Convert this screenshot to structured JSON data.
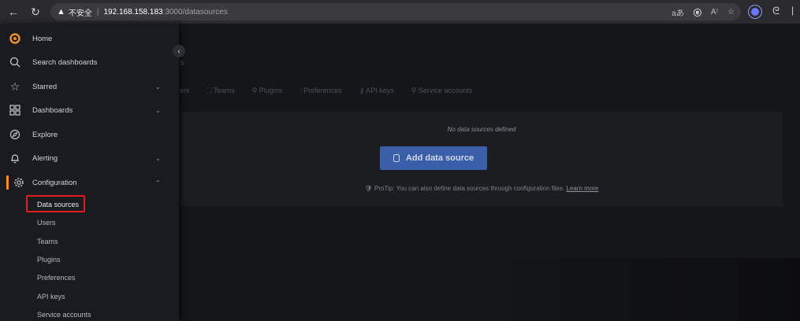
{
  "browser": {
    "insecure_label": "不安全",
    "url_host": "192.168.158.183",
    "url_path": ":3000/datasources",
    "tool_reader": "aあ",
    "tool_read_aloud": "A⁾",
    "tool_fav": "☆"
  },
  "sidebar": {
    "items": [
      {
        "label": "Home"
      },
      {
        "label": "Search dashboards"
      },
      {
        "label": "Starred"
      },
      {
        "label": "Dashboards"
      },
      {
        "label": "Explore"
      },
      {
        "label": "Alerting"
      },
      {
        "label": "Configuration"
      }
    ],
    "config_subitems": [
      {
        "label": "Data sources"
      },
      {
        "label": "Users"
      },
      {
        "label": "Teams"
      },
      {
        "label": "Plugins"
      },
      {
        "label": "Preferences"
      },
      {
        "label": "API keys"
      },
      {
        "label": "Service accounts"
      }
    ]
  },
  "main": {
    "title_fragment": "s",
    "tabs": [
      {
        "label": "ers"
      },
      {
        "label": "Teams"
      },
      {
        "label": "Plugins"
      },
      {
        "label": "Preferences"
      },
      {
        "label": "API keys"
      },
      {
        "label": "Service accounts"
      }
    ],
    "empty_message": "No data sources defined",
    "add_button_label": "Add data source",
    "protip_text": "ProTip: You can also define data sources through configuration files.",
    "learn_more": "Learn more"
  },
  "colors": {
    "accent": "#f28e2b",
    "primary_button": "#3b5ea8",
    "highlight_box": "#e21b1b"
  }
}
